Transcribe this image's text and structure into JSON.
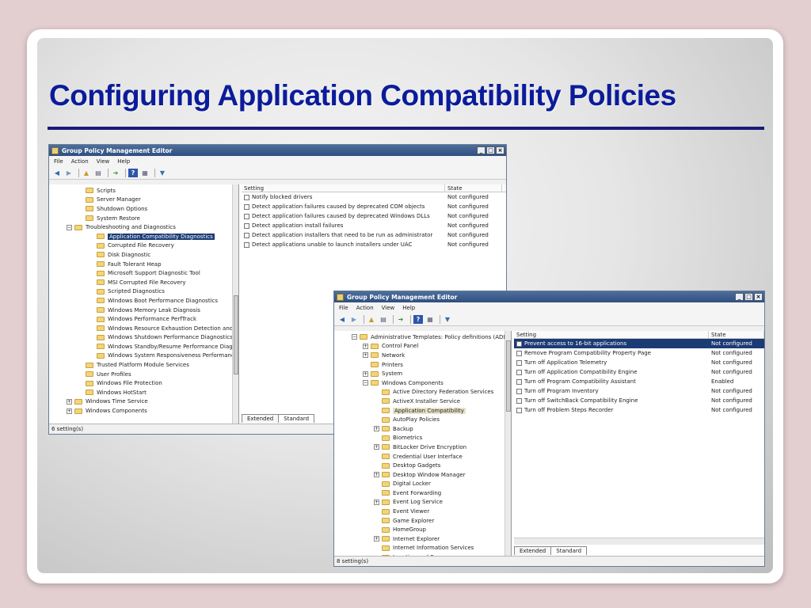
{
  "slide": {
    "title": "Configuring Application Compatibility Policies"
  },
  "colors": {
    "title": "#0b1c9a",
    "selection": "#1b3b74",
    "titlebar": "#3b5c8c"
  },
  "window1": {
    "title": "Group Policy Management Editor",
    "caption": {
      "min": "_",
      "max": "□",
      "close": "×"
    },
    "menu": [
      "File",
      "Action",
      "View",
      "Help"
    ],
    "tree": [
      {
        "label": "Scripts",
        "indent": 1,
        "exp": ""
      },
      {
        "label": "Server Manager",
        "indent": 1,
        "exp": ""
      },
      {
        "label": "Shutdown Options",
        "indent": 1,
        "exp": ""
      },
      {
        "label": "System Restore",
        "indent": 1,
        "exp": ""
      },
      {
        "label": "Troubleshooting and Diagnostics",
        "indent": 0,
        "exp": "−"
      },
      {
        "label": "Application Compatibility Diagnostics",
        "indent": 2,
        "exp": "",
        "state": "sel"
      },
      {
        "label": "Corrupted File Recovery",
        "indent": 2,
        "exp": ""
      },
      {
        "label": "Disk Diagnostic",
        "indent": 2,
        "exp": ""
      },
      {
        "label": "Fault Tolerant Heap",
        "indent": 2,
        "exp": ""
      },
      {
        "label": "Microsoft Support Diagnostic Tool",
        "indent": 2,
        "exp": ""
      },
      {
        "label": "MSI Corrupted File Recovery",
        "indent": 2,
        "exp": ""
      },
      {
        "label": "Scripted Diagnostics",
        "indent": 2,
        "exp": ""
      },
      {
        "label": "Windows Boot Performance Diagnostics",
        "indent": 2,
        "exp": ""
      },
      {
        "label": "Windows Memory Leak Diagnosis",
        "indent": 2,
        "exp": ""
      },
      {
        "label": "Windows Performance PerfTrack",
        "indent": 2,
        "exp": ""
      },
      {
        "label": "Windows Resource Exhaustion Detection and R",
        "indent": 2,
        "exp": ""
      },
      {
        "label": "Windows Shutdown Performance Diagnostics",
        "indent": 2,
        "exp": ""
      },
      {
        "label": "Windows Standby/Resume Performance Diagno",
        "indent": 2,
        "exp": ""
      },
      {
        "label": "Windows System Responsiveness Performance",
        "indent": 2,
        "exp": ""
      },
      {
        "label": "Trusted Platform Module Services",
        "indent": 1,
        "exp": ""
      },
      {
        "label": "User Profiles",
        "indent": 1,
        "exp": ""
      },
      {
        "label": "Windows File Protection",
        "indent": 1,
        "exp": ""
      },
      {
        "label": "Windows HotStart",
        "indent": 1,
        "exp": ""
      },
      {
        "label": "Windows Time Service",
        "indent": 0,
        "exp": "+"
      },
      {
        "label": "Windows Components",
        "indent": 0,
        "exp": "+"
      }
    ],
    "columns": {
      "setting": "Setting",
      "state": "State"
    },
    "rows": [
      {
        "setting": "Notify blocked drivers",
        "state": "Not configured"
      },
      {
        "setting": "Detect application failures caused by deprecated COM objects",
        "state": "Not configured"
      },
      {
        "setting": "Detect application failures caused by deprecated Windows DLLs",
        "state": "Not configured"
      },
      {
        "setting": "Detect application install failures",
        "state": "Not configured"
      },
      {
        "setting": "Detect application installers that need to be run as administrator",
        "state": "Not configured"
      },
      {
        "setting": "Detect applications unable to launch installers under UAC",
        "state": "Not configured"
      }
    ],
    "tabs": [
      "Extended",
      "Standard"
    ],
    "status": "6 setting(s)"
  },
  "window2": {
    "title": "Group Policy Management Editor",
    "caption": {
      "min": "_",
      "max": "□",
      "close": "×"
    },
    "menu": [
      "File",
      "Action",
      "View",
      "Help"
    ],
    "tree": [
      {
        "label": "Administrative Templates: Policy definitions (ADI",
        "indent": 0,
        "exp": "−"
      },
      {
        "label": "Control Panel",
        "indent": 1,
        "exp": "+"
      },
      {
        "label": "Network",
        "indent": 1,
        "exp": "+"
      },
      {
        "label": "Printers",
        "indent": 1,
        "exp": ""
      },
      {
        "label": "System",
        "indent": 1,
        "exp": "+"
      },
      {
        "label": "Windows Components",
        "indent": 1,
        "exp": "−"
      },
      {
        "label": "Active Directory Federation Services",
        "indent": 2,
        "exp": ""
      },
      {
        "label": "ActiveX Installer Service",
        "indent": 2,
        "exp": ""
      },
      {
        "label": "Application Compatibility",
        "indent": 2,
        "exp": "",
        "state": "hl"
      },
      {
        "label": "AutoPlay Policies",
        "indent": 2,
        "exp": ""
      },
      {
        "label": "Backup",
        "indent": 2,
        "exp": "+"
      },
      {
        "label": "Biometrics",
        "indent": 2,
        "exp": ""
      },
      {
        "label": "BitLocker Drive Encryption",
        "indent": 2,
        "exp": "+"
      },
      {
        "label": "Credential User Interface",
        "indent": 2,
        "exp": ""
      },
      {
        "label": "Desktop Gadgets",
        "indent": 2,
        "exp": ""
      },
      {
        "label": "Desktop Window Manager",
        "indent": 2,
        "exp": "+"
      },
      {
        "label": "Digital Locker",
        "indent": 2,
        "exp": ""
      },
      {
        "label": "Event Forwarding",
        "indent": 2,
        "exp": ""
      },
      {
        "label": "Event Log Service",
        "indent": 2,
        "exp": "+"
      },
      {
        "label": "Event Viewer",
        "indent": 2,
        "exp": ""
      },
      {
        "label": "Game Explorer",
        "indent": 2,
        "exp": ""
      },
      {
        "label": "HomeGroup",
        "indent": 2,
        "exp": ""
      },
      {
        "label": "Internet Explorer",
        "indent": 2,
        "exp": "+"
      },
      {
        "label": "Internet Information Services",
        "indent": 2,
        "exp": ""
      },
      {
        "label": "Location and Sensors",
        "indent": 2,
        "exp": ""
      }
    ],
    "columns": {
      "setting": "Setting",
      "state": "State"
    },
    "rows": [
      {
        "setting": "Prevent access to 16-bit applications",
        "state": "Not configured",
        "sel": true
      },
      {
        "setting": "Remove Program Compatibility Property Page",
        "state": "Not configured"
      },
      {
        "setting": "Turn off Application Telemetry",
        "state": "Not configured"
      },
      {
        "setting": "Turn off Application Compatibility Engine",
        "state": "Not configured"
      },
      {
        "setting": "Turn off Program Compatibility Assistant",
        "state": "Enabled"
      },
      {
        "setting": "Turn off Program Inventory",
        "state": "Not configured"
      },
      {
        "setting": "Turn off SwitchBack Compatibility Engine",
        "state": "Not configured"
      },
      {
        "setting": "Turn off Problem Steps Recorder",
        "state": "Not configured"
      }
    ],
    "tabs": [
      "Extended",
      "Standard"
    ],
    "status": "8 setting(s)"
  }
}
